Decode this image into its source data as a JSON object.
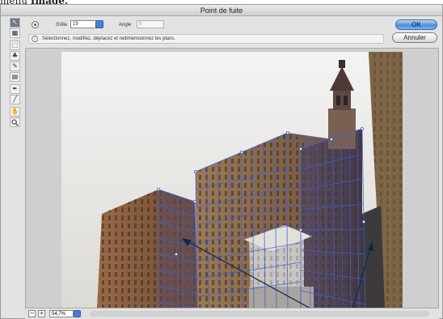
{
  "caption": {
    "prefix": "menu ",
    "bold": "Image."
  },
  "window": {
    "title": "Point de fuite"
  },
  "toolbox": {
    "tools": [
      {
        "name": "edit-plane-tool-icon",
        "glyph": "↖",
        "active": true
      },
      {
        "name": "create-plane-tool-icon",
        "glyph": "▦",
        "active": false
      },
      {
        "name": "marquee-tool-icon",
        "glyph": "⬚",
        "active": false
      },
      {
        "name": "stamp-tool-icon",
        "glyph": "♣",
        "active": false
      },
      {
        "name": "brush-tool-icon",
        "glyph": "✎",
        "active": false
      },
      {
        "name": "transform-tool-icon",
        "glyph": "▤",
        "active": false
      },
      {
        "name": "eyedropper-tool-icon",
        "glyph": "✒",
        "active": false
      },
      {
        "name": "measure-tool-icon",
        "glyph": "╱",
        "active": false
      },
      {
        "name": "hand-tool-icon",
        "glyph": "✋",
        "active": false
      },
      {
        "name": "zoom-tool-icon",
        "glyph": "🔍",
        "active": false
      }
    ]
  },
  "options": {
    "grille_label": "Grille",
    "grille_value": "19",
    "angle_label": "Angle",
    "angle_value": "0"
  },
  "hint": {
    "text": "Sélectionnez, modifiez, déplacez et redimensionnez les plans."
  },
  "buttons": {
    "ok": "OK",
    "cancel": "Annuler"
  },
  "zoom": {
    "minus": "−",
    "plus": "+",
    "value": "54,7%"
  },
  "colors": {
    "grid": "#3a5fd8",
    "accent": "#4a80d4"
  }
}
